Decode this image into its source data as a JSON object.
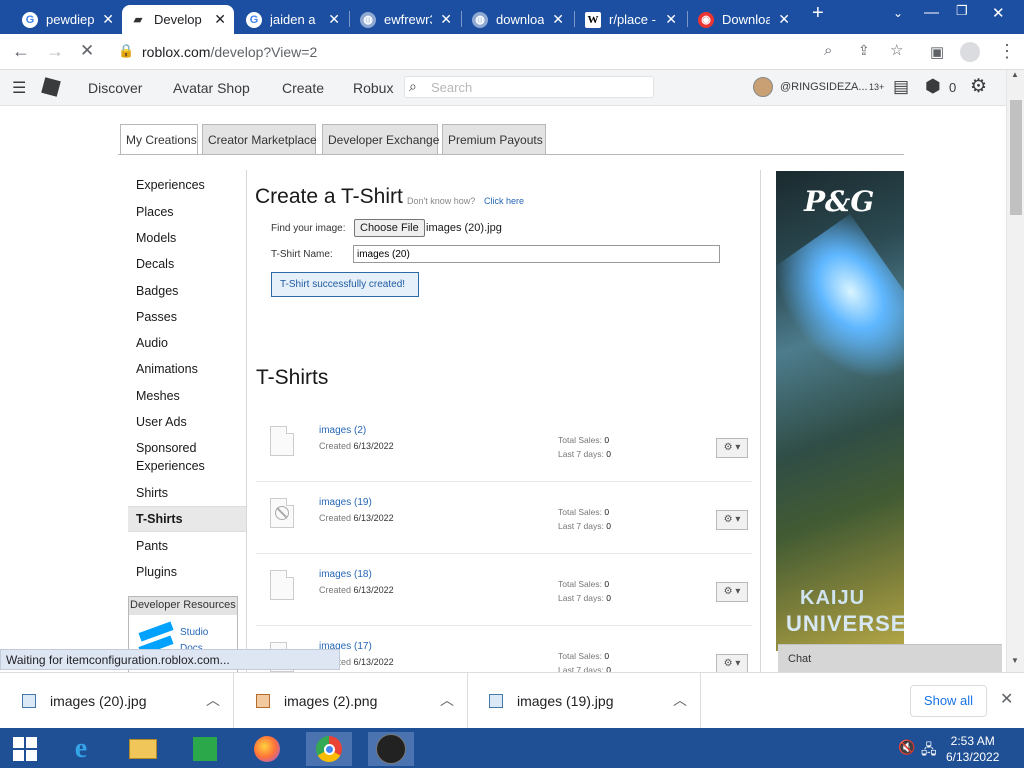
{
  "browser": {
    "tabs": [
      {
        "title": "pewdiep",
        "icon": "google-icon"
      },
      {
        "title": "Develop",
        "icon": "roblox-icon",
        "active": true
      },
      {
        "title": "jaiden a",
        "icon": "google-icon"
      },
      {
        "title": "ewfrewr3",
        "icon": "globe-icon"
      },
      {
        "title": "downloa",
        "icon": "globe-icon"
      },
      {
        "title": "r/place -",
        "icon": "wikipedia-icon"
      },
      {
        "title": "Downloa",
        "icon": "roblox-red-icon"
      }
    ],
    "url_host": "roblox.com",
    "url_path": "/develop?View=2"
  },
  "header": {
    "nav": [
      "Discover",
      "Avatar Shop",
      "Create",
      "Robux"
    ],
    "search_placeholder": "Search",
    "username": "@RINGSIDEZA...",
    "age_badge": "13+",
    "robux": "0"
  },
  "top_tabs": [
    "My Creations",
    "Creator Marketplace",
    "Developer Exchange",
    "Premium Payouts"
  ],
  "sidebar": {
    "items": [
      "Experiences",
      "Places",
      "Models",
      "Decals",
      "Badges",
      "Passes",
      "Audio",
      "Animations",
      "Meshes",
      "User Ads",
      "Sponsored",
      "Experiences",
      "Shirts",
      "T-Shirts",
      "Pants",
      "Plugins"
    ],
    "dev_resources_title": "Developer Resources",
    "studio_label": "Studio",
    "docs_label": "Docs"
  },
  "create": {
    "title": "Create a T-Shirt",
    "help_text": "Don't know how?",
    "help_link": "Click here",
    "find_label": "Find your image:",
    "choose_file": "Choose File",
    "file_name": "images (20).jpg",
    "name_label": "T-Shirt Name:",
    "name_value": "images (20)",
    "success": "T-Shirt successfully created!"
  },
  "list": {
    "title": "T-Shirts",
    "created_label": "Created",
    "total_sales_label": "Total Sales:",
    "last7_label": "Last 7 days:",
    "rows": [
      {
        "name": "images (2)",
        "created": "6/13/2022",
        "total": "0",
        "last7": "0"
      },
      {
        "name": "images (19)",
        "created": "6/13/2022",
        "total": "0",
        "last7": "0"
      },
      {
        "name": "images (18)",
        "created": "6/13/2022",
        "total": "0",
        "last7": "0"
      },
      {
        "name": "images (17)",
        "created": "6/13/2022",
        "total": "0",
        "last7": "0"
      }
    ]
  },
  "ad": {
    "logo": "P&G",
    "line1": "KAIJU",
    "line2": "UNIVERSE"
  },
  "chat_label": "Chat",
  "status_text": "Waiting for itemconfiguration.roblox.com...",
  "downloads": {
    "items": [
      "images (20).jpg",
      "images (2).png",
      "images (19).jpg"
    ],
    "show_all": "Show all"
  },
  "taskbar": {
    "time": "2:53 AM",
    "date": "6/13/2022"
  }
}
